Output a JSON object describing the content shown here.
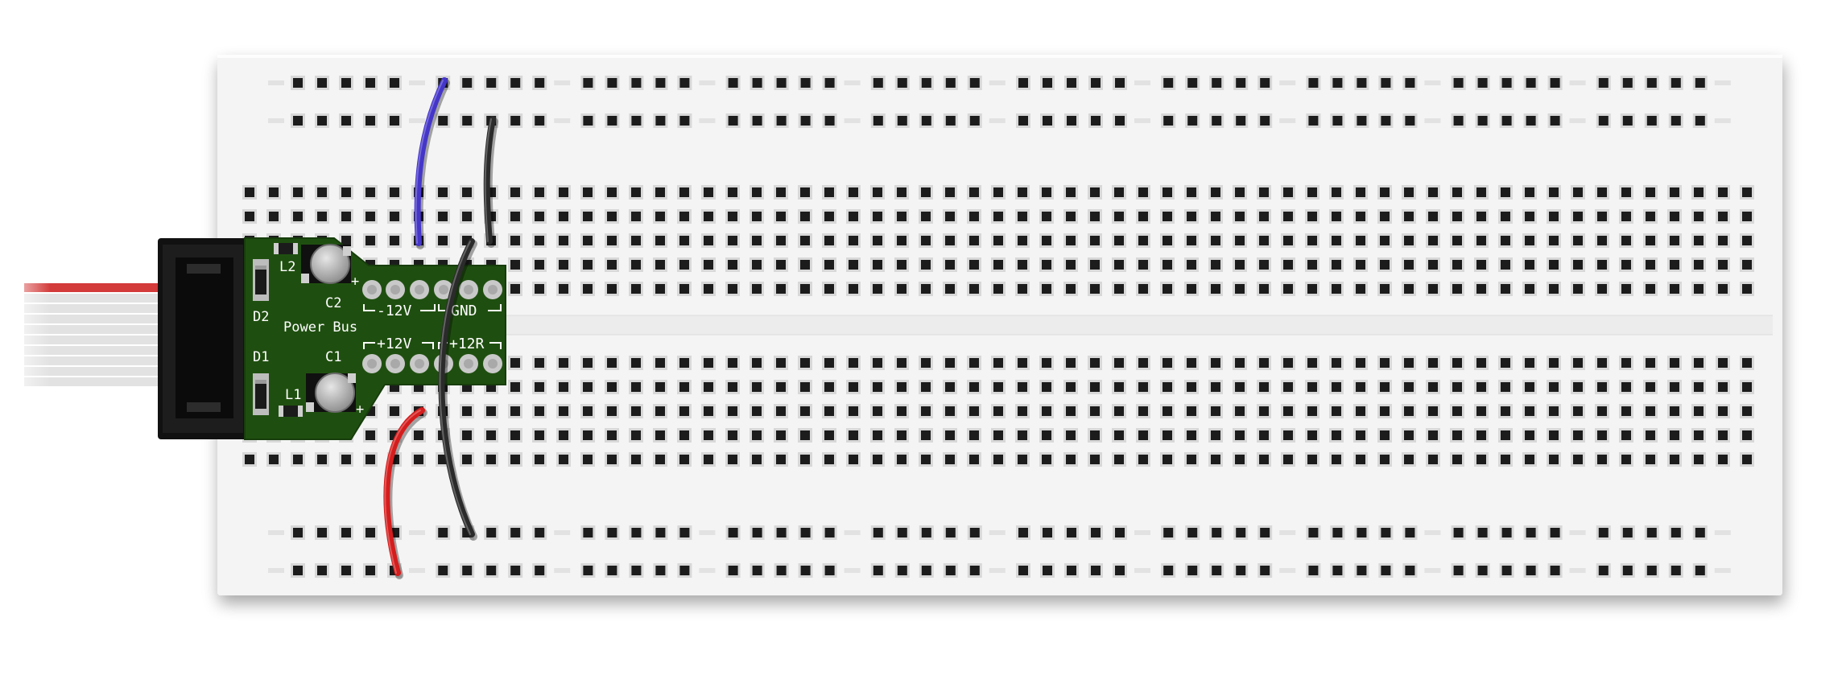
{
  "breadboard": {
    "rail_sections": 10,
    "holes_per_rail_section": 5,
    "main_columns": 63,
    "rows_per_block": 5,
    "colors": {
      "board": "#f4f4f4",
      "hole": "#1c1c1c",
      "hole_rim": "#d8d8d8"
    }
  },
  "module": {
    "title": "Power Bus",
    "labels": {
      "l2": "L2",
      "l1": "L1",
      "c2": "C2",
      "c1": "C1",
      "d2": "D2",
      "d1": "D1",
      "plus": "+"
    },
    "pin_labels": {
      "neg12v": "-12V",
      "gnd": "GND",
      "pos12v": "+12V",
      "pos12r": "+12R"
    },
    "colors": {
      "pcb": "#1f4f10",
      "pad": "#c9c9c9",
      "connector": "#111111"
    }
  },
  "ribbon_cable": {
    "wires": 10,
    "colors": {
      "stripe": "#d33a3a",
      "wire": "#e2e2e2"
    }
  },
  "jumpers": [
    {
      "name": "blue-jumper",
      "color": "#4536c9"
    },
    {
      "name": "black-jumper-top",
      "color": "#2b2b2b"
    },
    {
      "name": "black-jumper-long",
      "color": "#2b2b2b"
    },
    {
      "name": "red-jumper",
      "color": "#d51d1d"
    }
  ]
}
